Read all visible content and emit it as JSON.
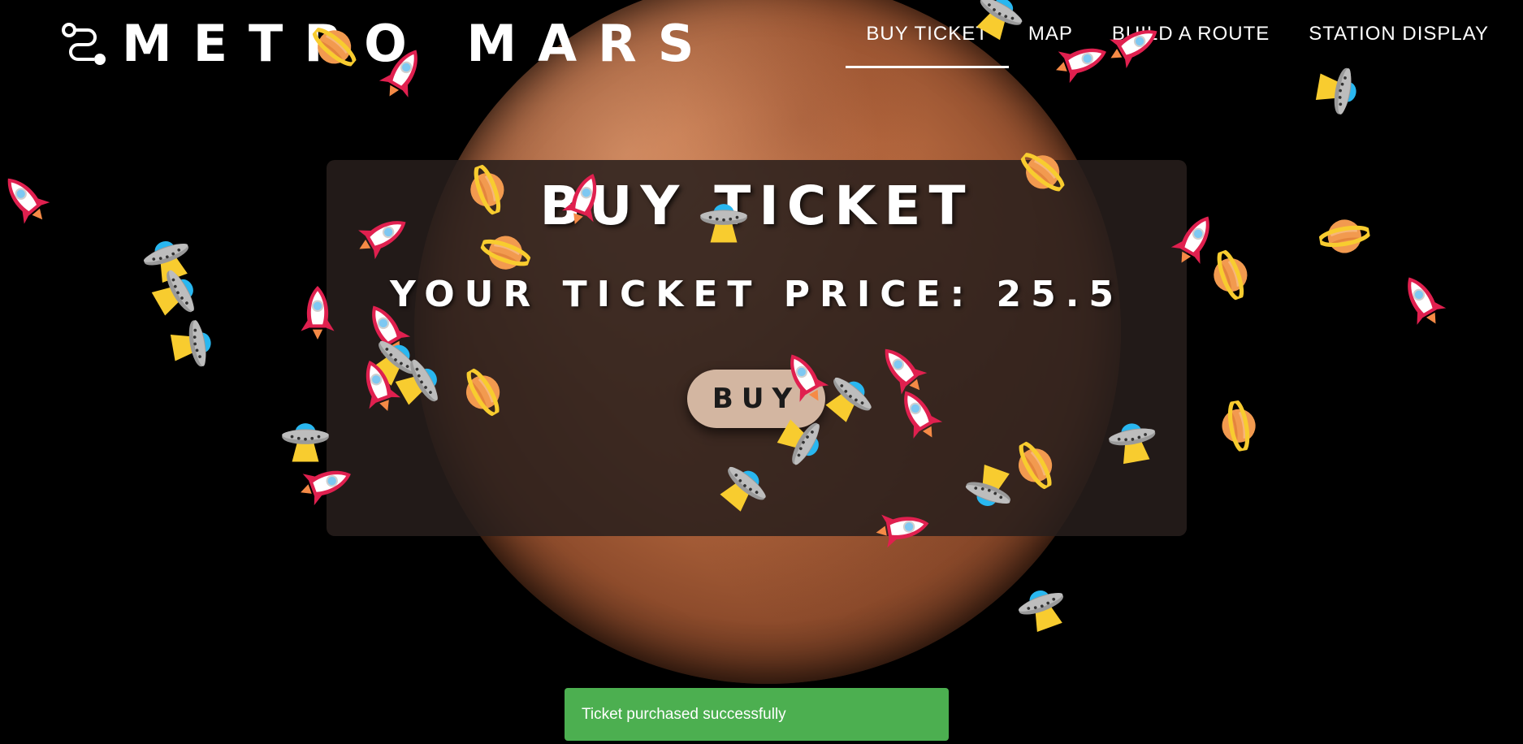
{
  "header": {
    "logo_icon": "route-icon",
    "title": "METRO MARS",
    "nav": [
      {
        "label": "BUY TICKET",
        "active": true
      },
      {
        "label": "MAP",
        "active": false
      },
      {
        "label": "BUILD A ROUTE",
        "active": false
      },
      {
        "label": "STATION DISPLAY",
        "active": false
      }
    ]
  },
  "main": {
    "title": "BUY TICKET",
    "price_text": "YOUR TICKET PRICE: 25.5",
    "buy_label": "BUY"
  },
  "snackbar": {
    "message": "Ticket purchased successfully"
  },
  "colors": {
    "background": "#000000",
    "snackbar": "#4caf50",
    "button": "#d3b6a1",
    "rocket": "#e0204f",
    "ufo": "#9a9a9a",
    "planet": "#f29a4f",
    "ring": "#f8cc2f"
  },
  "decorations": {
    "icons": [
      "rocket-icon",
      "ufo-icon",
      "planet-icon"
    ]
  }
}
